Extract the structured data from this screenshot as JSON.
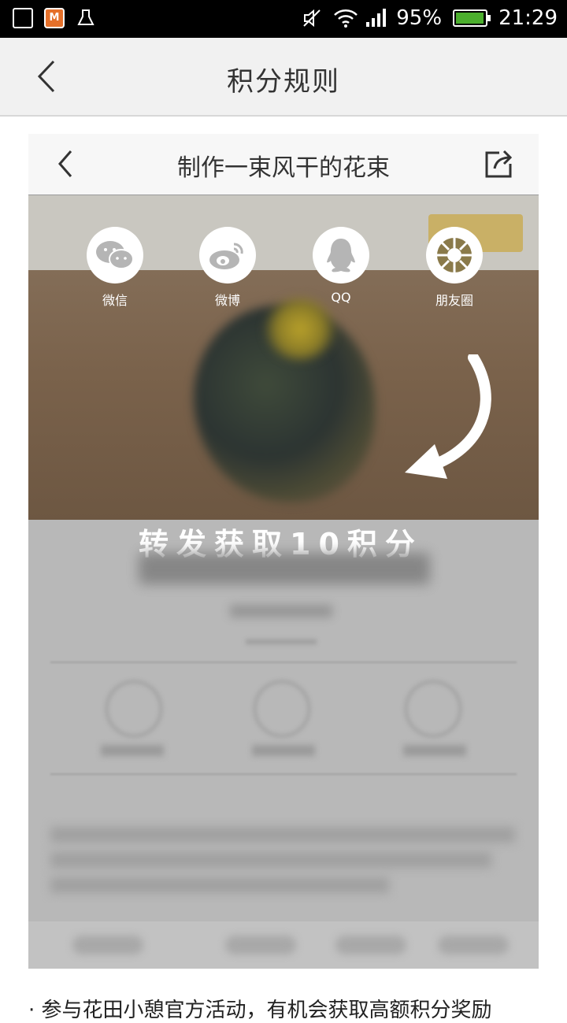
{
  "status_bar": {
    "battery": "95%",
    "time": "21:29"
  },
  "header": {
    "title": "积分规则"
  },
  "illustration": {
    "inner_title": "制作一束风干的花束",
    "share_targets": [
      {
        "label": "微信",
        "icon": "wechat-icon"
      },
      {
        "label": "微博",
        "icon": "weibo-icon"
      },
      {
        "label": "QQ",
        "icon": "qq-icon"
      },
      {
        "label": "朋友圈",
        "icon": "moments-icon"
      }
    ],
    "promo": "转发获取10积分"
  },
  "footer": {
    "text": "· 参与花田小憩官方活动，有机会获取高额积分奖励"
  }
}
